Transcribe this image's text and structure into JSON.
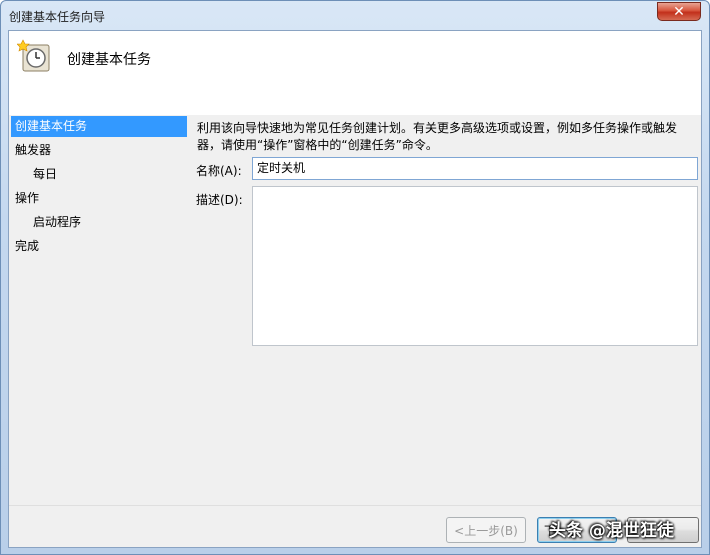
{
  "window": {
    "title": "创建基本任务向导",
    "close_glyph": "✕"
  },
  "header": {
    "title": "创建基本任务",
    "icon": "clock-task-icon"
  },
  "nav": {
    "items": [
      {
        "label": "创建基本任务",
        "selected": true,
        "sub": false
      },
      {
        "label": "触发器",
        "selected": false,
        "sub": false
      },
      {
        "label": "每日",
        "selected": false,
        "sub": true
      },
      {
        "label": "操作",
        "selected": false,
        "sub": false
      },
      {
        "label": "启动程序",
        "selected": false,
        "sub": true
      },
      {
        "label": "完成",
        "selected": false,
        "sub": false
      }
    ]
  },
  "main": {
    "description": "利用该向导快速地为常见任务创建计划。有关更多高级选项或设置，例如多任务操作或触发器，请使用“操作”窗格中的“创建任务”命令。",
    "name_label": "名称(A):",
    "name_value": "定时关机",
    "desc_label": "描述(D):",
    "desc_value": ""
  },
  "footer": {
    "back_label": "<上一步(B)",
    "next_label": "下一步"
  },
  "watermark": "头条 @混世狂徒",
  "colors": {
    "selection": "#3399ff",
    "close": "#c2301b"
  }
}
